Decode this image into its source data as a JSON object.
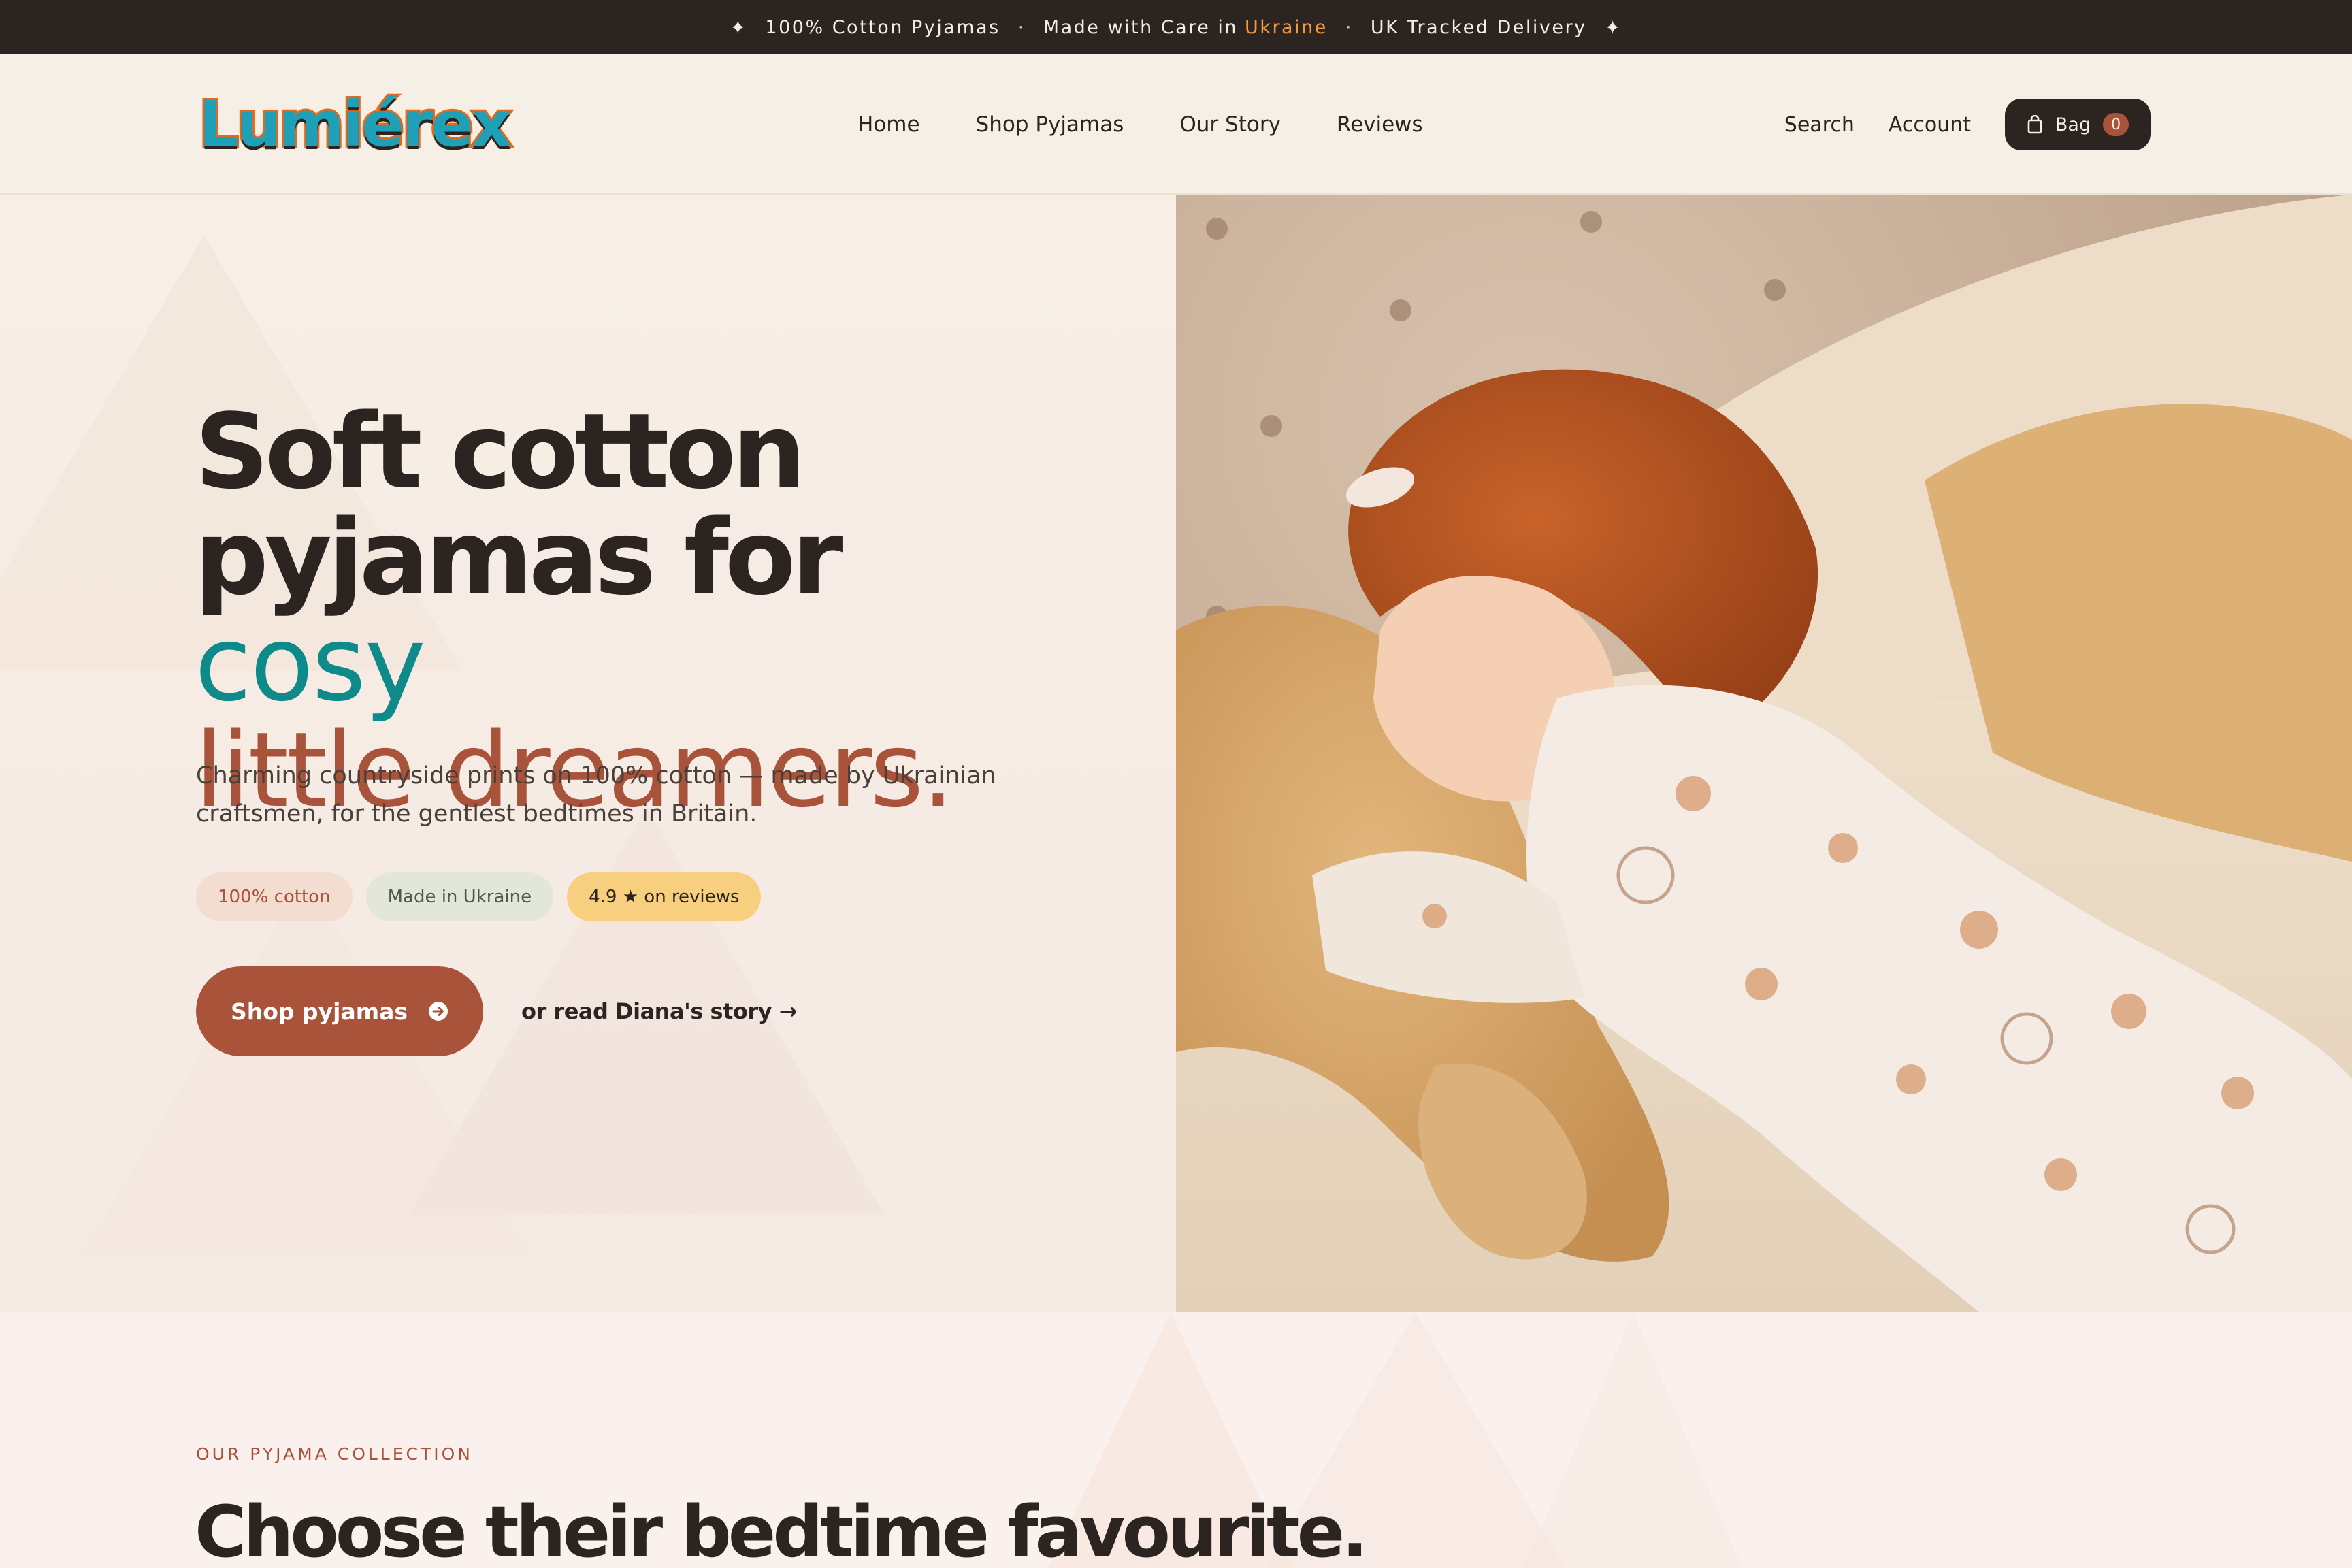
{
  "announcement": {
    "item1": "100% Cotton Pyjamas",
    "item2_prefix": "Made with Care in",
    "item2_accent": "Ukraine",
    "item3": "UK Tracked Delivery",
    "star": "✦",
    "separator": "·",
    "accent_color": "#f29a3f"
  },
  "brand": {
    "logo_text": "Lumiérex"
  },
  "nav": {
    "items": [
      {
        "label": "Home"
      },
      {
        "label": "Shop Pyjamas"
      },
      {
        "label": "Our Story"
      },
      {
        "label": "Reviews"
      }
    ]
  },
  "header_actions": {
    "search": "Search",
    "account": "Account",
    "bag_label": "Bag",
    "bag_count": "0",
    "bag_icon": "shopping-bag-icon"
  },
  "hero": {
    "headline_line1": "Soft cotton",
    "headline_line2_a": "pyjamas for ",
    "headline_line2_b": "cosy",
    "headline_line3": "little dreamers.",
    "subtitle": "Charming countryside prints on 100% cotton — made by Ukrainian craftsmen, for the gentlest bedtimes in Britain.",
    "chips": [
      {
        "label": "100% cotton"
      },
      {
        "label": "Made in Ukraine"
      },
      {
        "label": "4.9 ★ on reviews"
      }
    ],
    "cta_label": "Shop pyjamas",
    "cta_icon": "arrow-right-circle-icon",
    "story_link": "or read Diana's story →",
    "image_subject": "girl-sleeping-with-dog-photo"
  },
  "collection": {
    "eyebrow": "OUR PYJAMA COLLECTION",
    "title": "Choose their bedtime favourite."
  },
  "colors": {
    "ink": "#2b2420",
    "rust": "#a9533a",
    "teal": "#0e8a8a",
    "cream": "#f6efe6"
  }
}
